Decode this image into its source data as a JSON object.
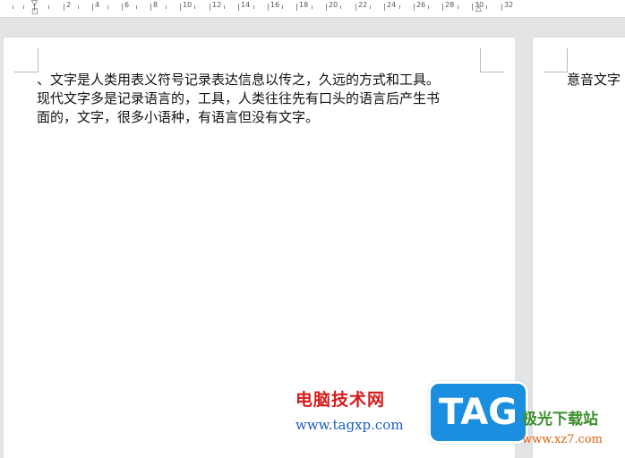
{
  "ruler": {
    "labels": [
      "2",
      "4",
      "6",
      "8",
      "10",
      "12",
      "14",
      "16",
      "18",
      "20",
      "22",
      "24",
      "26",
      "28",
      "30",
      "32"
    ]
  },
  "document": {
    "page1_lines": [
      "、文字是人类用表义符号记录表达信息以传之，久远的方式和工具。",
      "现代文字多是记录语言的，工具，人类往往先有口头的语言后产生书",
      "面的，文字，很多小语种，有语言但没有文字。"
    ],
    "page2_text": "意音文字"
  },
  "watermark": {
    "site_name": "电脑技术网",
    "site_url": "www.tagxp.com",
    "tag_logo": "TAG",
    "right_name": "极光下载站",
    "right_url": "www.xz7.com"
  },
  "colors": {
    "background": "#e3e4e6",
    "page": "#ffffff",
    "watermark_red": "#d61c1c",
    "watermark_blue": "#1a5fbf",
    "tag_blue": "#1a8fe0",
    "right_green": "#3b8f2c",
    "right_orange": "#e06010"
  }
}
